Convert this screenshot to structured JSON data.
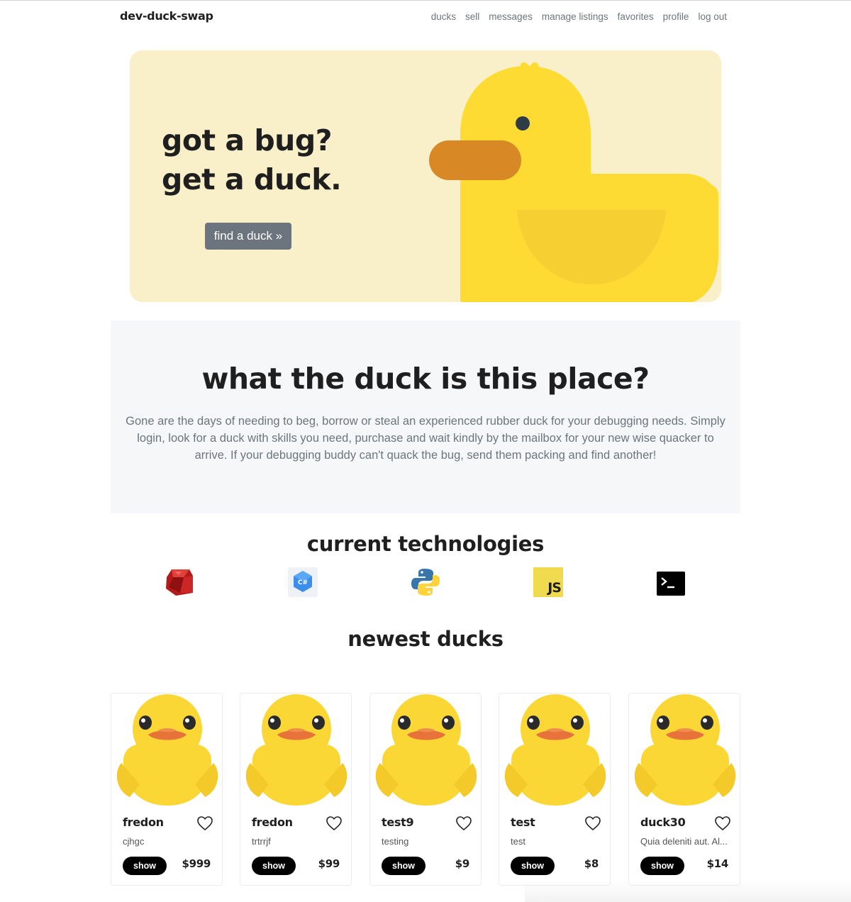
{
  "nav": {
    "brand": "dev-duck-swap",
    "links": [
      "ducks",
      "sell",
      "messages",
      "manage listings",
      "favorites",
      "profile",
      "log out"
    ]
  },
  "hero": {
    "line1": "got a bug?",
    "line2": "get a duck.",
    "button": "find a duck »",
    "colors": {
      "background": "#f9efc8",
      "duck_body": "#fddb32",
      "duck_beak": "#d98826",
      "button": "#6c757d"
    }
  },
  "about": {
    "title": "what the duck is this place?",
    "text": "Gone are the days of needing to beg, borrow or steal an experienced rubber duck for your debugging needs. Simply login, look for a duck with skills you need, purchase and wait kindly by the mailbox for your new wise quacker to arrive. If your debugging buddy can't quack the bug, send them packing and find another!"
  },
  "technologies": {
    "title": "current technologies",
    "icons": [
      "ruby-icon",
      "csharp-icon",
      "python-icon",
      "javascript-icon",
      "terminal-icon"
    ],
    "js_label": "JS",
    "csharp_label": "C#"
  },
  "newest": {
    "title": "newest ducks",
    "cards": [
      {
        "name": "fredon",
        "desc": "cjhgc",
        "price": "$999",
        "show": "show"
      },
      {
        "name": "fredon",
        "desc": "trtrrjf",
        "price": "$99",
        "show": "show"
      },
      {
        "name": "test9",
        "desc": "testing",
        "price": "$9",
        "show": "show"
      },
      {
        "name": "test",
        "desc": "test",
        "price": "$8",
        "show": "show"
      },
      {
        "name": "duck30",
        "desc": "Quia deleniti aut. Al...",
        "price": "$14",
        "show": "show"
      }
    ]
  }
}
